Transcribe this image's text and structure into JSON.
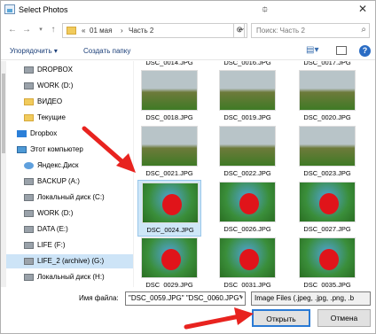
{
  "window": {
    "title": "Select Photos"
  },
  "address": {
    "crumb_prefix": "«",
    "crumbs": [
      "01 мая",
      "Часть 2"
    ],
    "separator": "›",
    "search_placeholder": "Поиск: Часть 2"
  },
  "toolbar": {
    "organize": "Упорядочить ▾",
    "new_folder": "Создать папку"
  },
  "nav_items": [
    {
      "label": "DROPBOX",
      "icon": "drive-icon",
      "selected": false
    },
    {
      "label": "WORK (D:)",
      "icon": "drive-icon",
      "selected": false
    },
    {
      "label": "ВИДЕО",
      "icon": "folder-icon",
      "selected": false
    },
    {
      "label": "Текущие",
      "icon": "folder-icon",
      "selected": false
    },
    {
      "label": "Dropbox",
      "icon": "dropbox-icon",
      "selected": false
    },
    {
      "label": "Этот компьютер",
      "icon": "computer-icon",
      "selected": false
    },
    {
      "label": "Яндекс.Диск",
      "icon": "yandex-disk-icon",
      "selected": false
    },
    {
      "label": "BACKUP (A:)",
      "icon": "drive-icon",
      "selected": false
    },
    {
      "label": "Локальный диск (C:)",
      "icon": "drive-icon",
      "selected": false
    },
    {
      "label": "WORK (D:)",
      "icon": "drive-icon",
      "selected": false
    },
    {
      "label": "DATA (E:)",
      "icon": "drive-icon",
      "selected": false
    },
    {
      "label": "LIFE (F:)",
      "icon": "drive-icon",
      "selected": false
    },
    {
      "label": "LIFE_2 (archive) (G:)",
      "icon": "drive-icon",
      "selected": true
    },
    {
      "label": "Локальный диск (H:)",
      "icon": "drive-icon",
      "selected": false
    }
  ],
  "files": {
    "partial_top": [
      "DSC_0014.JPG",
      "DSC_0016.JPG",
      "DSC_0017.JPG"
    ],
    "rows": [
      [
        "DSC_0018.JPG",
        "DSC_0019.JPG",
        "DSC_0020.JPG"
      ],
      [
        "DSC_0021.JPG",
        "DSC_0022.JPG",
        "DSC_0023.JPG"
      ],
      [
        "DSC_0024.JPG",
        "DSC_0026.JPG",
        "DSC_0027.JPG"
      ],
      [
        "DSC_0029.JPG",
        "DSC_0031.JPG",
        "DSC_0035.JPG"
      ]
    ]
  },
  "footer": {
    "filename_label": "Имя файла:",
    "filename_value": "\"DSC_0059.JPG\" \"DSC_0060.JPG\"",
    "filter_value": "Image Files (.jpeg, .jpg, .png, .b",
    "open_label": "Открыть",
    "cancel_label": "Отмена"
  },
  "colors": {
    "accent": "#2a7ad4",
    "arrow": "#e8231f",
    "selection": "#cde4f7"
  }
}
